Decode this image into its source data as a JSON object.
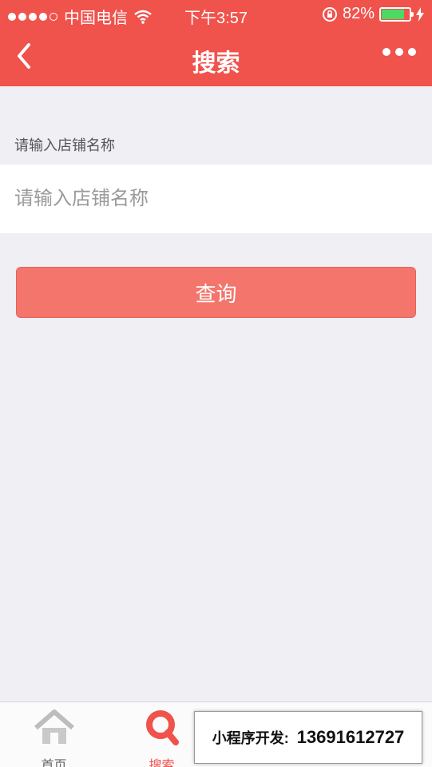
{
  "status_bar": {
    "carrier": "中国电信",
    "time": "下午3:57",
    "battery_percent": "82%",
    "battery_level": 0.82,
    "icons": [
      "signal-dots-icon",
      "wifi-icon",
      "rotation-lock-icon",
      "battery-icon",
      "charging-icon"
    ]
  },
  "nav": {
    "title": "搜索",
    "back_icon": "chevron-left-icon",
    "more_icon": "more-dots-icon"
  },
  "form": {
    "label": "请输入店铺名称",
    "input_value": "",
    "input_placeholder": "请输入店铺名称",
    "submit_label": "查询"
  },
  "tabbar": {
    "items": [
      {
        "label": "首页",
        "icon": "home-icon",
        "active": false
      },
      {
        "label": "搜索",
        "icon": "search-icon",
        "active": true
      },
      {
        "label": "",
        "icon": "tab3-icon",
        "active": false
      },
      {
        "label": "",
        "icon": "tab4-icon",
        "active": false
      }
    ]
  },
  "promo": {
    "label": "小程序开发:",
    "phone": "13691612727"
  },
  "colors": {
    "brand": "#f0524c",
    "button": "#f4756c",
    "background": "#efeff4",
    "battery": "#4cd964"
  }
}
